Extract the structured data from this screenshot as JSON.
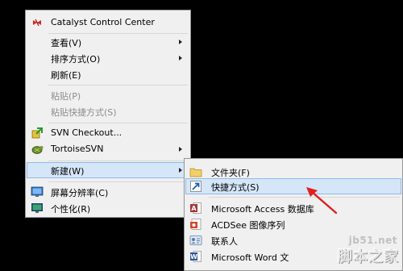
{
  "context_menu": {
    "items": [
      {
        "label": "Catalyst Control Center",
        "icon": "catalyst-icon"
      },
      {
        "label": "查看(V)",
        "submenu": true
      },
      {
        "label": "排序方式(O)",
        "submenu": true
      },
      {
        "label": "刷新(E)"
      },
      {
        "label": "粘贴(P)",
        "disabled": true
      },
      {
        "label": "粘贴快捷方式(S)",
        "disabled": true
      },
      {
        "label": "SVN Checkout...",
        "icon": "svn-checkout-icon"
      },
      {
        "label": "TortoiseSVN",
        "icon": "tortoisesvn-icon",
        "submenu": true
      },
      {
        "label": "新建(W)",
        "submenu": true,
        "highlighted": true
      },
      {
        "label": "屏幕分辨率(C)",
        "icon": "screen-resolution-icon"
      },
      {
        "label": "个性化(R)",
        "icon": "personalize-icon"
      }
    ]
  },
  "new_submenu": {
    "items": [
      {
        "label": "文件夹(F)",
        "icon": "folder-icon"
      },
      {
        "label": "快捷方式(S)",
        "icon": "shortcut-icon",
        "highlighted": true
      },
      {
        "label": "Microsoft Access 数据库",
        "icon": "access-icon"
      },
      {
        "label": "ACDSee 图像序列",
        "icon": "acdsee-icon"
      },
      {
        "label": "联系人",
        "icon": "contact-icon"
      },
      {
        "label": "Microsoft Word 文",
        "icon": "word-icon"
      }
    ]
  },
  "watermark": {
    "url": "jb51.net",
    "name": "脚本之家"
  },
  "colors": {
    "highlight_fill": "#d5e6f8",
    "highlight_border": "#8fbbe8",
    "pointer_arrow": "#e02020"
  }
}
